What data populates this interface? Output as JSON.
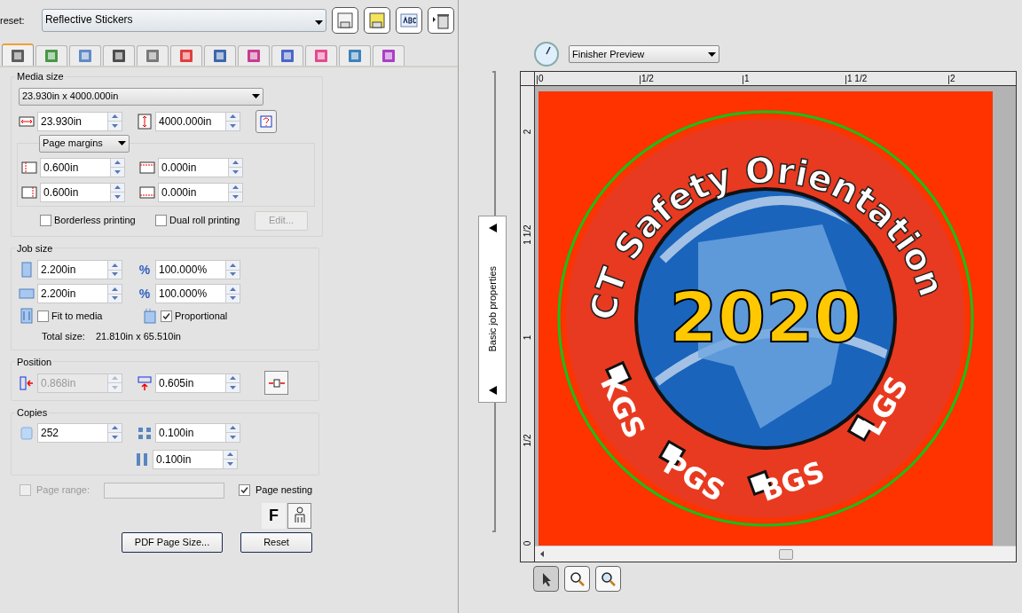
{
  "preset": {
    "label": "reset:",
    "value": "Reflective Stickers"
  },
  "tabs": [
    {
      "selected": true
    },
    {
      "selected": false
    },
    {
      "selected": false
    },
    {
      "selected": false
    },
    {
      "selected": false
    },
    {
      "selected": false
    },
    {
      "selected": false
    },
    {
      "selected": false
    },
    {
      "selected": false
    },
    {
      "selected": false
    },
    {
      "selected": false
    },
    {
      "selected": false
    }
  ],
  "media_size": {
    "title": "Media size",
    "size_select": "23.930in x 4000.000in",
    "width": "23.930in",
    "height": "4000.000in",
    "margins_select": "Page margins",
    "margin_left": "0.600in",
    "margin_top": "0.000in",
    "margin_right": "0.600in",
    "margin_bottom": "0.000in",
    "borderless": {
      "label": "Borderless printing",
      "checked": false
    },
    "dual_roll": {
      "label": "Dual roll printing",
      "checked": false
    },
    "edit_button": {
      "label": "Edit...",
      "disabled": true
    }
  },
  "job_size": {
    "title": "Job size",
    "width": "2.200in",
    "width_percent": "100.000%",
    "height": "2.200in",
    "height_percent": "100.000%",
    "percent_symbol": "%",
    "fit_to_media": {
      "label": "Fit to media",
      "checked": false
    },
    "proportional": {
      "label": "Proportional",
      "checked": true
    },
    "total_label": "Total size:",
    "total_value": "21.810in x 65.510in"
  },
  "position": {
    "title": "Position",
    "x": {
      "value": "0.868in",
      "disabled": true
    },
    "y": {
      "value": "0.605in",
      "disabled": false
    }
  },
  "copies": {
    "title": "Copies",
    "count": "252",
    "h_gap": "0.100in",
    "v_gap": "0.100in"
  },
  "page_range": {
    "label": "Page range:",
    "checked": false,
    "disabled": true
  },
  "page_nesting": {
    "label": "Page nesting",
    "checked": true
  },
  "f_button": "F",
  "buttons": [
    "PDF Page Size...",
    "Reset"
  ],
  "side_panel": {
    "label": "Basic job properties"
  },
  "preview": {
    "mode_select": "Finisher Preview",
    "top_ruler": [
      "0",
      "1/2",
      "1",
      "1 1/2",
      "2"
    ],
    "left_ruler": [
      "2",
      "1 1/2",
      "1",
      "1/2",
      "0"
    ],
    "artwork": {
      "title": "CT Safety Orientation",
      "year": "2020",
      "labels": [
        "KGS",
        "PGS",
        "BGS",
        "LGS"
      ]
    }
  }
}
